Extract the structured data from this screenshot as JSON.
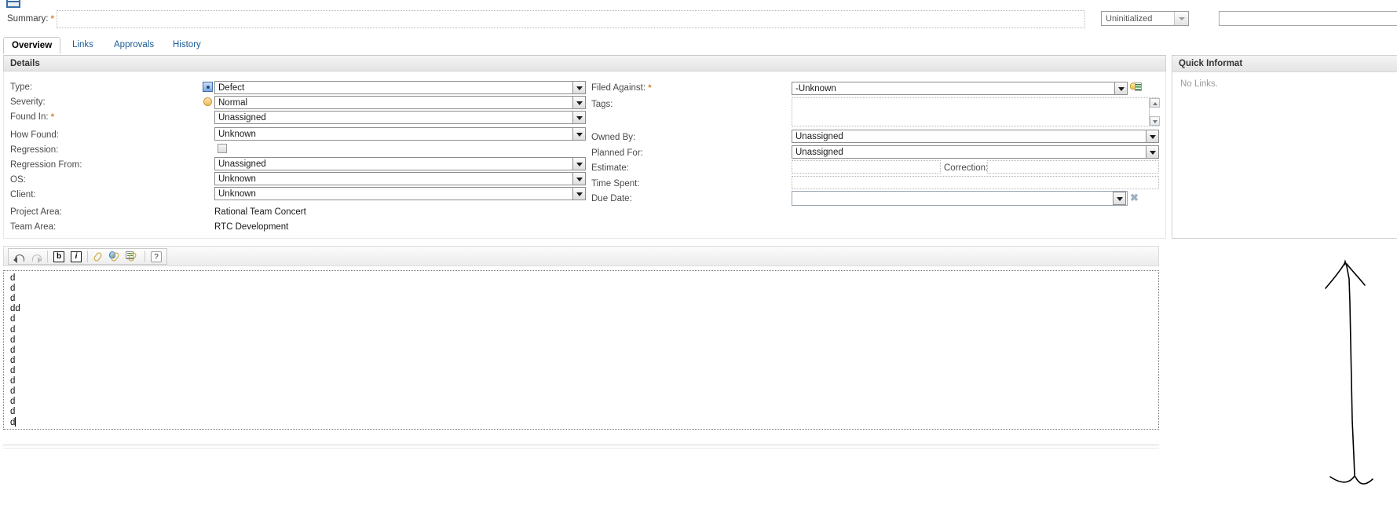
{
  "window": {
    "app_icon": "document-icon"
  },
  "summary": {
    "label": "Summary:",
    "required_marker": "*",
    "value": "",
    "placeholder": ""
  },
  "state": {
    "value": "Uninitialized",
    "dropdown_icon": "chevron-down-icon"
  },
  "tabs": [
    {
      "label": "Overview",
      "active": true
    },
    {
      "label": "Links",
      "active": false
    },
    {
      "label": "Approvals",
      "active": false
    },
    {
      "label": "History",
      "active": false
    }
  ],
  "details": {
    "section_title": "Details",
    "left_fields": [
      {
        "label": "Type:",
        "value": "Defect",
        "control": "combo",
        "icon": "defect-type-icon",
        "required": false
      },
      {
        "label": "Severity:",
        "value": "Normal",
        "control": "combo",
        "icon": "severity-normal-icon",
        "required": false
      },
      {
        "label": "Found In:",
        "value": "Unassigned",
        "control": "combo",
        "icon": null,
        "required": true
      },
      {
        "label": "How Found:",
        "value": "Unknown",
        "control": "combo",
        "icon": null,
        "required": false
      },
      {
        "label": "Regression:",
        "value": "",
        "control": "checkbox",
        "icon": null,
        "required": false
      },
      {
        "label": "Regression From:",
        "value": "Unassigned",
        "control": "combo",
        "icon": null,
        "required": false
      },
      {
        "label": "OS:",
        "value": "Unknown",
        "control": "combo",
        "icon": null,
        "required": false
      },
      {
        "label": "Client:",
        "value": "Unknown",
        "control": "combo",
        "icon": null,
        "required": false
      },
      {
        "label": "Project Area:",
        "value": "Rational Team Concert",
        "control": "static",
        "icon": null,
        "required": false
      },
      {
        "label": "Team Area:",
        "value": "RTC Development",
        "control": "static",
        "icon": null,
        "required": false
      }
    ],
    "right_fields": [
      {
        "label": "Filed Against:",
        "value": "-Unknown",
        "control": "combo",
        "required": true,
        "side_icon": "filed-against-picker-icon"
      },
      {
        "label": "Tags:",
        "value": "",
        "control": "textarea",
        "required": false,
        "side_icon": null
      },
      {
        "label": "Owned By:",
        "value": "Unassigned",
        "control": "combo",
        "required": false,
        "side_icon": null
      },
      {
        "label": "Planned For:",
        "value": "Unassigned",
        "control": "combo",
        "required": false,
        "side_icon": null
      },
      {
        "label": "Estimate:",
        "value": "",
        "control": "dotted",
        "required": false,
        "side_icon": null
      },
      {
        "label": "Time Spent:",
        "value": "",
        "control": "dotted",
        "required": false,
        "side_icon": null
      },
      {
        "label": "Due Date:",
        "value": "",
        "control": "datepicker",
        "required": false,
        "side_icon": "clear-date-icon"
      }
    ],
    "correction": {
      "label": "Correction:",
      "value": ""
    }
  },
  "quick_information": {
    "title": "Quick Informat",
    "empty_text": "No Links."
  },
  "description_editor": {
    "toolbar": [
      {
        "name": "undo-icon",
        "label": "Undo",
        "enabled": true
      },
      {
        "name": "redo-icon",
        "label": "Redo",
        "enabled": false
      },
      {
        "name": "bold-icon",
        "label": "b",
        "enabled": true
      },
      {
        "name": "italic-icon",
        "label": "i",
        "enabled": true
      },
      {
        "name": "attach-link-icon",
        "label": "Link",
        "enabled": true
      },
      {
        "name": "attach-user-icon",
        "label": "Link to User",
        "enabled": true
      },
      {
        "name": "attach-item-icon",
        "label": "Link to Item",
        "enabled": true
      },
      {
        "name": "help-icon",
        "label": "?",
        "enabled": true
      }
    ],
    "content_lines": [
      "d",
      "d",
      "d",
      "dd",
      "d",
      "d",
      "d",
      "d",
      "d",
      "d",
      "d",
      "d",
      "d",
      "d",
      "d"
    ],
    "cursor_on_last_line": true
  },
  "annotation": {
    "type": "double-headed-vertical-arrow",
    "color": "#000000"
  },
  "colors": {
    "required_star": "#d87d28",
    "tab_link": "#1a5a96",
    "panel_header_bg": "#eeeeee",
    "field_border": "#8d8d8d"
  }
}
